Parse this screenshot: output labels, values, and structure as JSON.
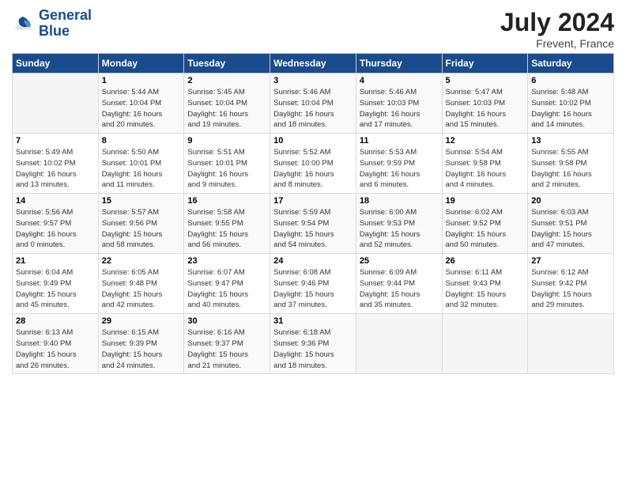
{
  "header": {
    "logo_line1": "General",
    "logo_line2": "Blue",
    "month": "July 2024",
    "location": "Frevent, France"
  },
  "weekdays": [
    "Sunday",
    "Monday",
    "Tuesday",
    "Wednesday",
    "Thursday",
    "Friday",
    "Saturday"
  ],
  "weeks": [
    [
      {
        "day": "",
        "info": ""
      },
      {
        "day": "1",
        "info": "Sunrise: 5:44 AM\nSunset: 10:04 PM\nDaylight: 16 hours\nand 20 minutes."
      },
      {
        "day": "2",
        "info": "Sunrise: 5:45 AM\nSunset: 10:04 PM\nDaylight: 16 hours\nand 19 minutes."
      },
      {
        "day": "3",
        "info": "Sunrise: 5:46 AM\nSunset: 10:04 PM\nDaylight: 16 hours\nand 18 minutes."
      },
      {
        "day": "4",
        "info": "Sunrise: 5:46 AM\nSunset: 10:03 PM\nDaylight: 16 hours\nand 17 minutes."
      },
      {
        "day": "5",
        "info": "Sunrise: 5:47 AM\nSunset: 10:03 PM\nDaylight: 16 hours\nand 15 minutes."
      },
      {
        "day": "6",
        "info": "Sunrise: 5:48 AM\nSunset: 10:02 PM\nDaylight: 16 hours\nand 14 minutes."
      }
    ],
    [
      {
        "day": "7",
        "info": "Sunrise: 5:49 AM\nSunset: 10:02 PM\nDaylight: 16 hours\nand 13 minutes."
      },
      {
        "day": "8",
        "info": "Sunrise: 5:50 AM\nSunset: 10:01 PM\nDaylight: 16 hours\nand 11 minutes."
      },
      {
        "day": "9",
        "info": "Sunrise: 5:51 AM\nSunset: 10:01 PM\nDaylight: 16 hours\nand 9 minutes."
      },
      {
        "day": "10",
        "info": "Sunrise: 5:52 AM\nSunset: 10:00 PM\nDaylight: 16 hours\nand 8 minutes."
      },
      {
        "day": "11",
        "info": "Sunrise: 5:53 AM\nSunset: 9:59 PM\nDaylight: 16 hours\nand 6 minutes."
      },
      {
        "day": "12",
        "info": "Sunrise: 5:54 AM\nSunset: 9:58 PM\nDaylight: 16 hours\nand 4 minutes."
      },
      {
        "day": "13",
        "info": "Sunrise: 5:55 AM\nSunset: 9:58 PM\nDaylight: 16 hours\nand 2 minutes."
      }
    ],
    [
      {
        "day": "14",
        "info": "Sunrise: 5:56 AM\nSunset: 9:57 PM\nDaylight: 16 hours\nand 0 minutes."
      },
      {
        "day": "15",
        "info": "Sunrise: 5:57 AM\nSunset: 9:56 PM\nDaylight: 15 hours\nand 58 minutes."
      },
      {
        "day": "16",
        "info": "Sunrise: 5:58 AM\nSunset: 9:55 PM\nDaylight: 15 hours\nand 56 minutes."
      },
      {
        "day": "17",
        "info": "Sunrise: 5:59 AM\nSunset: 9:54 PM\nDaylight: 15 hours\nand 54 minutes."
      },
      {
        "day": "18",
        "info": "Sunrise: 6:00 AM\nSunset: 9:53 PM\nDaylight: 15 hours\nand 52 minutes."
      },
      {
        "day": "19",
        "info": "Sunrise: 6:02 AM\nSunset: 9:52 PM\nDaylight: 15 hours\nand 50 minutes."
      },
      {
        "day": "20",
        "info": "Sunrise: 6:03 AM\nSunset: 9:51 PM\nDaylight: 15 hours\nand 47 minutes."
      }
    ],
    [
      {
        "day": "21",
        "info": "Sunrise: 6:04 AM\nSunset: 9:49 PM\nDaylight: 15 hours\nand 45 minutes."
      },
      {
        "day": "22",
        "info": "Sunrise: 6:05 AM\nSunset: 9:48 PM\nDaylight: 15 hours\nand 42 minutes."
      },
      {
        "day": "23",
        "info": "Sunrise: 6:07 AM\nSunset: 9:47 PM\nDaylight: 15 hours\nand 40 minutes."
      },
      {
        "day": "24",
        "info": "Sunrise: 6:08 AM\nSunset: 9:46 PM\nDaylight: 15 hours\nand 37 minutes."
      },
      {
        "day": "25",
        "info": "Sunrise: 6:09 AM\nSunset: 9:44 PM\nDaylight: 15 hours\nand 35 minutes."
      },
      {
        "day": "26",
        "info": "Sunrise: 6:11 AM\nSunset: 9:43 PM\nDaylight: 15 hours\nand 32 minutes."
      },
      {
        "day": "27",
        "info": "Sunrise: 6:12 AM\nSunset: 9:42 PM\nDaylight: 15 hours\nand 29 minutes."
      }
    ],
    [
      {
        "day": "28",
        "info": "Sunrise: 6:13 AM\nSunset: 9:40 PM\nDaylight: 15 hours\nand 26 minutes."
      },
      {
        "day": "29",
        "info": "Sunrise: 6:15 AM\nSunset: 9:39 PM\nDaylight: 15 hours\nand 24 minutes."
      },
      {
        "day": "30",
        "info": "Sunrise: 6:16 AM\nSunset: 9:37 PM\nDaylight: 15 hours\nand 21 minutes."
      },
      {
        "day": "31",
        "info": "Sunrise: 6:18 AM\nSunset: 9:36 PM\nDaylight: 15 hours\nand 18 minutes."
      },
      {
        "day": "",
        "info": ""
      },
      {
        "day": "",
        "info": ""
      },
      {
        "day": "",
        "info": ""
      }
    ]
  ]
}
